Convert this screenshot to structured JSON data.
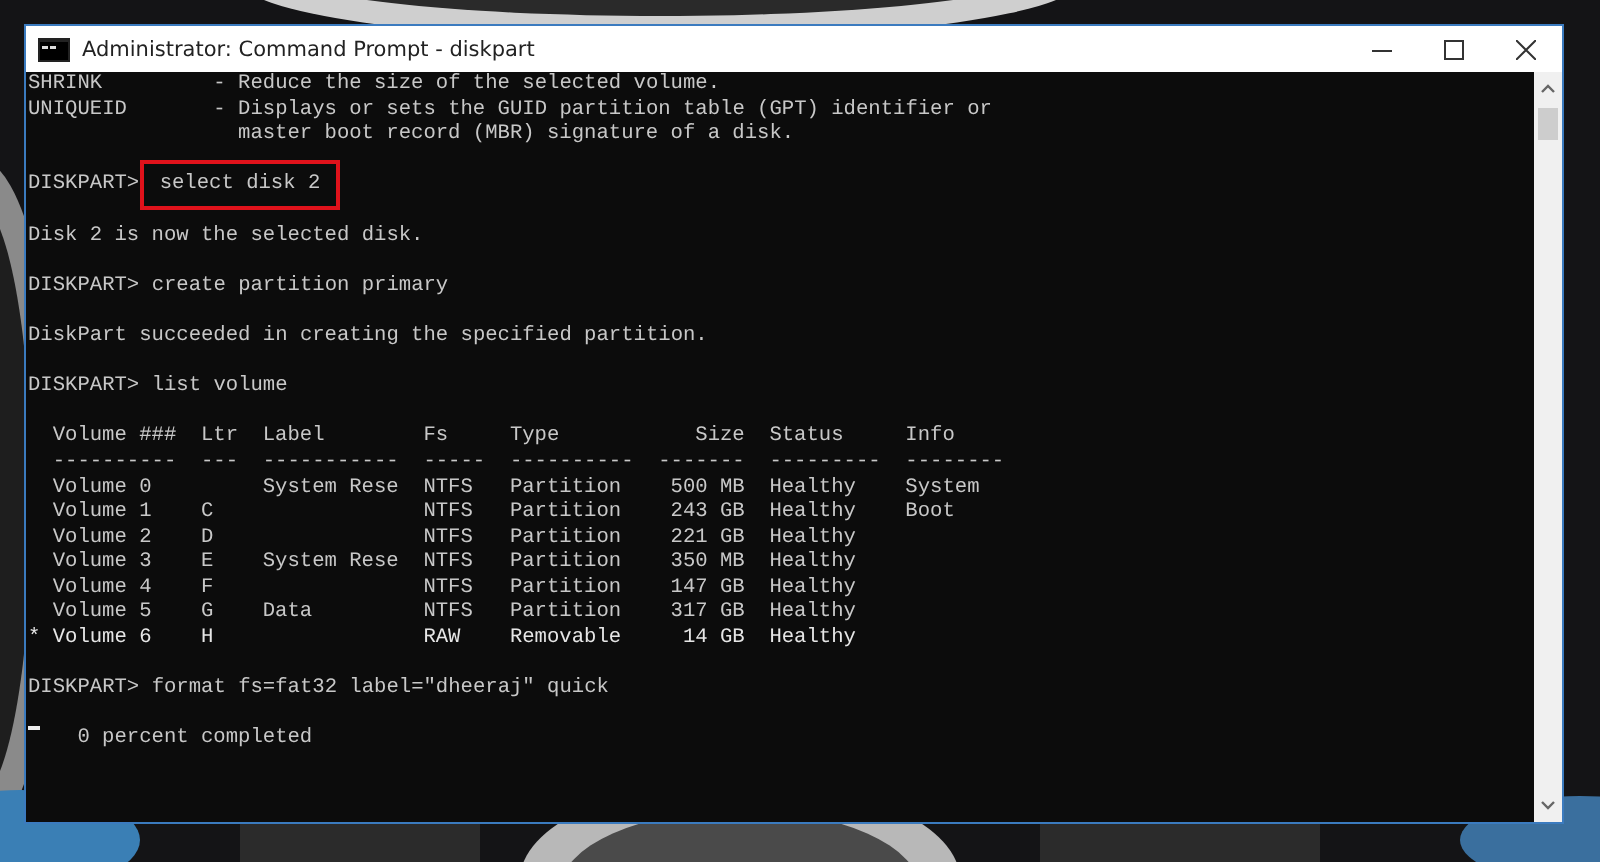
{
  "window": {
    "title": "Administrator: Command Prompt - diskpart"
  },
  "console": [
    {
      "kind": "help",
      "name": "SHRINK",
      "lines": [
        "- Reduce the size of the selected volume."
      ]
    },
    {
      "kind": "help",
      "name": "UNIQUEID",
      "lines": [
        "- Displays or sets the GUID partition table (GPT) identifier or",
        "master boot record (MBR) signature of a disk."
      ]
    },
    {
      "kind": "command",
      "prompt": "DISKPART>",
      "command": "select disk 2",
      "highlighted": true
    },
    {
      "kind": "output",
      "text": "Disk 2 is now the selected disk."
    },
    {
      "kind": "command",
      "prompt": "DISKPART>",
      "command": "create partition primary",
      "highlighted": false
    },
    {
      "kind": "output",
      "text": "DiskPart succeeded in creating the specified partition."
    },
    {
      "kind": "command",
      "prompt": "DISKPART>",
      "command": "list volume",
      "highlighted": false
    },
    {
      "kind": "table",
      "columns": [
        {
          "heading": "Volume ###",
          "rule": "----------"
        },
        {
          "heading": "Ltr",
          "rule": "---"
        },
        {
          "heading": "Label",
          "rule": "-----------"
        },
        {
          "heading": "Fs",
          "rule": "-----"
        },
        {
          "heading": "Type",
          "rule": "----------"
        },
        {
          "heading": "Size",
          "rule": "-------"
        },
        {
          "heading": "Status",
          "rule": "---------"
        },
        {
          "heading": "Info",
          "rule": "--------"
        }
      ],
      "rows": [
        {
          "volume": "Volume 0",
          "label": "System Rese",
          "fs": "NTFS",
          "type": "Partition",
          "size": "500 MB",
          "status": "Healthy",
          "info": "System",
          "selected": false
        },
        {
          "volume": "Volume 1",
          "ltr": "C",
          "fs": "NTFS",
          "type": "Partition",
          "size": "243 GB",
          "status": "Healthy",
          "info": "Boot",
          "selected": false
        },
        {
          "volume": "Volume 2",
          "ltr": "D",
          "fs": "NTFS",
          "type": "Partition",
          "size": "221 GB",
          "status": "Healthy",
          "selected": false
        },
        {
          "volume": "Volume 3",
          "ltr": "E",
          "label": "System Rese",
          "fs": "NTFS",
          "type": "Partition",
          "size": "350 MB",
          "status": "Healthy",
          "selected": false
        },
        {
          "volume": "Volume 4",
          "ltr": "F",
          "fs": "NTFS",
          "type": "Partition",
          "size": "147 GB",
          "status": "Healthy",
          "selected": false
        },
        {
          "volume": "Volume 5",
          "ltr": "G",
          "label": "Data",
          "fs": "NTFS",
          "type": "Partition",
          "size": "317 GB",
          "status": "Healthy",
          "selected": false
        },
        {
          "marker": "*",
          "volume": "Volume 6",
          "ltr": "H",
          "fs": "RAW",
          "type": "Removable",
          "size": "14 GB",
          "status": "Healthy",
          "selected": true
        }
      ]
    },
    {
      "kind": "command",
      "prompt": "DISKPART>",
      "command": "format fs=fat32 label=\"dheeraj\" quick",
      "highlighted": false
    },
    {
      "kind": "progress",
      "text": "0 percent completed"
    }
  ]
}
